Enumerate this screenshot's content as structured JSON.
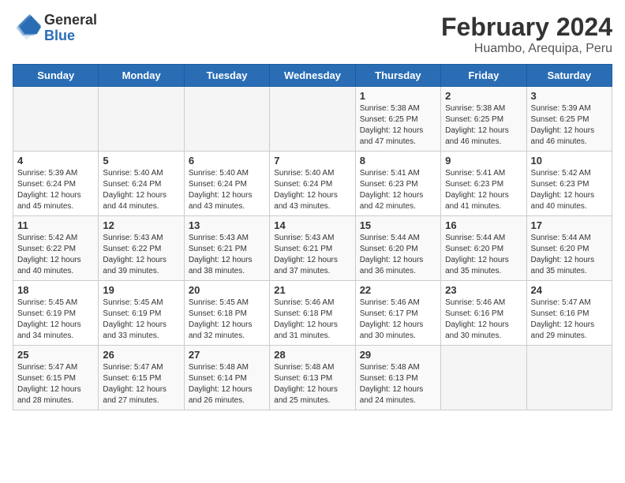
{
  "header": {
    "logo_general": "General",
    "logo_blue": "Blue",
    "title": "February 2024",
    "subtitle": "Huambo, Arequipa, Peru"
  },
  "days_of_week": [
    "Sunday",
    "Monday",
    "Tuesday",
    "Wednesday",
    "Thursday",
    "Friday",
    "Saturday"
  ],
  "weeks": [
    [
      {
        "day": "",
        "info": ""
      },
      {
        "day": "",
        "info": ""
      },
      {
        "day": "",
        "info": ""
      },
      {
        "day": "",
        "info": ""
      },
      {
        "day": "1",
        "info": "Sunrise: 5:38 AM\nSunset: 6:25 PM\nDaylight: 12 hours\nand 47 minutes."
      },
      {
        "day": "2",
        "info": "Sunrise: 5:38 AM\nSunset: 6:25 PM\nDaylight: 12 hours\nand 46 minutes."
      },
      {
        "day": "3",
        "info": "Sunrise: 5:39 AM\nSunset: 6:25 PM\nDaylight: 12 hours\nand 46 minutes."
      }
    ],
    [
      {
        "day": "4",
        "info": "Sunrise: 5:39 AM\nSunset: 6:24 PM\nDaylight: 12 hours\nand 45 minutes."
      },
      {
        "day": "5",
        "info": "Sunrise: 5:40 AM\nSunset: 6:24 PM\nDaylight: 12 hours\nand 44 minutes."
      },
      {
        "day": "6",
        "info": "Sunrise: 5:40 AM\nSunset: 6:24 PM\nDaylight: 12 hours\nand 43 minutes."
      },
      {
        "day": "7",
        "info": "Sunrise: 5:40 AM\nSunset: 6:24 PM\nDaylight: 12 hours\nand 43 minutes."
      },
      {
        "day": "8",
        "info": "Sunrise: 5:41 AM\nSunset: 6:23 PM\nDaylight: 12 hours\nand 42 minutes."
      },
      {
        "day": "9",
        "info": "Sunrise: 5:41 AM\nSunset: 6:23 PM\nDaylight: 12 hours\nand 41 minutes."
      },
      {
        "day": "10",
        "info": "Sunrise: 5:42 AM\nSunset: 6:23 PM\nDaylight: 12 hours\nand 40 minutes."
      }
    ],
    [
      {
        "day": "11",
        "info": "Sunrise: 5:42 AM\nSunset: 6:22 PM\nDaylight: 12 hours\nand 40 minutes."
      },
      {
        "day": "12",
        "info": "Sunrise: 5:43 AM\nSunset: 6:22 PM\nDaylight: 12 hours\nand 39 minutes."
      },
      {
        "day": "13",
        "info": "Sunrise: 5:43 AM\nSunset: 6:21 PM\nDaylight: 12 hours\nand 38 minutes."
      },
      {
        "day": "14",
        "info": "Sunrise: 5:43 AM\nSunset: 6:21 PM\nDaylight: 12 hours\nand 37 minutes."
      },
      {
        "day": "15",
        "info": "Sunrise: 5:44 AM\nSunset: 6:20 PM\nDaylight: 12 hours\nand 36 minutes."
      },
      {
        "day": "16",
        "info": "Sunrise: 5:44 AM\nSunset: 6:20 PM\nDaylight: 12 hours\nand 35 minutes."
      },
      {
        "day": "17",
        "info": "Sunrise: 5:44 AM\nSunset: 6:20 PM\nDaylight: 12 hours\nand 35 minutes."
      }
    ],
    [
      {
        "day": "18",
        "info": "Sunrise: 5:45 AM\nSunset: 6:19 PM\nDaylight: 12 hours\nand 34 minutes."
      },
      {
        "day": "19",
        "info": "Sunrise: 5:45 AM\nSunset: 6:19 PM\nDaylight: 12 hours\nand 33 minutes."
      },
      {
        "day": "20",
        "info": "Sunrise: 5:45 AM\nSunset: 6:18 PM\nDaylight: 12 hours\nand 32 minutes."
      },
      {
        "day": "21",
        "info": "Sunrise: 5:46 AM\nSunset: 6:18 PM\nDaylight: 12 hours\nand 31 minutes."
      },
      {
        "day": "22",
        "info": "Sunrise: 5:46 AM\nSunset: 6:17 PM\nDaylight: 12 hours\nand 30 minutes."
      },
      {
        "day": "23",
        "info": "Sunrise: 5:46 AM\nSunset: 6:16 PM\nDaylight: 12 hours\nand 30 minutes."
      },
      {
        "day": "24",
        "info": "Sunrise: 5:47 AM\nSunset: 6:16 PM\nDaylight: 12 hours\nand 29 minutes."
      }
    ],
    [
      {
        "day": "25",
        "info": "Sunrise: 5:47 AM\nSunset: 6:15 PM\nDaylight: 12 hours\nand 28 minutes."
      },
      {
        "day": "26",
        "info": "Sunrise: 5:47 AM\nSunset: 6:15 PM\nDaylight: 12 hours\nand 27 minutes."
      },
      {
        "day": "27",
        "info": "Sunrise: 5:48 AM\nSunset: 6:14 PM\nDaylight: 12 hours\nand 26 minutes."
      },
      {
        "day": "28",
        "info": "Sunrise: 5:48 AM\nSunset: 6:13 PM\nDaylight: 12 hours\nand 25 minutes."
      },
      {
        "day": "29",
        "info": "Sunrise: 5:48 AM\nSunset: 6:13 PM\nDaylight: 12 hours\nand 24 minutes."
      },
      {
        "day": "",
        "info": ""
      },
      {
        "day": "",
        "info": ""
      }
    ]
  ]
}
